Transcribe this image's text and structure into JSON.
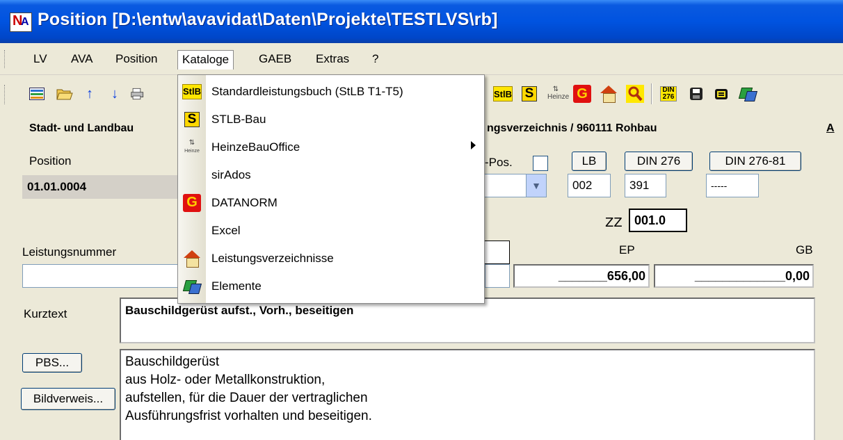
{
  "window": {
    "title": "Position [D:\\entw\\avavidat\\Daten\\Projekte\\TESTLVS\\rb]"
  },
  "menu": [
    "LV",
    "AVA",
    "Position",
    "Kataloge",
    "GAEB",
    "Extras",
    "?"
  ],
  "toolbar_icons": [
    "list-icon",
    "open-folder-icon",
    "arrow-up-icon",
    "arrow-down-icon",
    "print-icon",
    "stlb-icon",
    "s-icon",
    "heinze-icon",
    "datanorm-icon",
    "house-icon",
    "search-icon",
    "din276-icon",
    "disk-icon",
    "export-icon",
    "elements-icon"
  ],
  "toolbar_labels": {
    "stlb": "StlB",
    "s": "S",
    "din": "DIN 276"
  },
  "header": {
    "left": "Stadt- und Landbau",
    "right": "ngsverzeichnis / 960111  Rohbau",
    "edge": "A"
  },
  "form": {
    "position_label": "Position",
    "position_value": "01.01.0004",
    "pos_label": "-Pos.",
    "lb_button": "LB",
    "din276_button": "DIN 276",
    "din27681_button": "DIN 276-81",
    "lb_value": "002",
    "din276_value": "391",
    "din27681_value": "-----",
    "zz_label": "ZZ",
    "zz_value": "001.0",
    "leistungsnummer_label": "Leistungsnummer",
    "ep_label": "EP",
    "gb_label": "GB",
    "ep_value": "_______656,00",
    "gb_value": "_____________0,00",
    "kurztext_label": "Kurztext",
    "kurztext_value": "Bauschildgerüst aufst., Vorh., beseitigen",
    "pbs_button": "PBS...",
    "bildverweis_button": "Bildverweis...",
    "langtext": [
      "Bauschildgerüst",
      "aus Holz- oder Metallkonstruktion,",
      "aufstellen, für die Dauer der vertraglichen",
      "Ausführungsfrist vorhalten und beseitigen."
    ]
  },
  "kataloge_menu": {
    "items": [
      {
        "label": "Standardleistungsbuch (StLB T1-T5)",
        "icon": "stlb-icon",
        "icon_text": "StlB"
      },
      {
        "label": "STLB-Bau",
        "icon": "s-icon",
        "icon_text": "S"
      },
      {
        "label": "HeinzeBauOffice",
        "icon": "heinze-icon",
        "icon_text": "Heinze",
        "submenu": true
      },
      {
        "label": "sirAdos",
        "icon": ""
      },
      {
        "label": "DATANORM",
        "icon": "datanorm-icon",
        "icon_text": "G"
      },
      {
        "label": "Excel",
        "icon": ""
      },
      {
        "label": "Leistungsverzeichnisse",
        "icon": "house-icon"
      },
      {
        "label": "Elemente",
        "icon": "elements-icon"
      }
    ]
  }
}
